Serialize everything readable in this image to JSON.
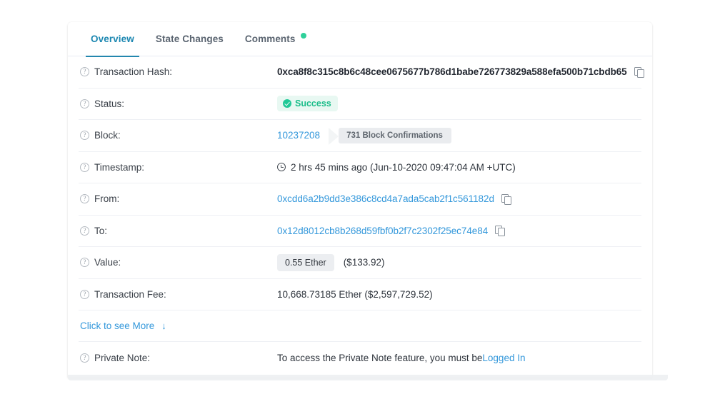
{
  "tabs": [
    {
      "label": "Overview",
      "active": true,
      "dot": false
    },
    {
      "label": "State Changes",
      "active": false,
      "dot": false
    },
    {
      "label": "Comments",
      "active": false,
      "dot": true
    }
  ],
  "rows": {
    "transaction_hash": {
      "label": "Transaction Hash:",
      "value": "0xca8f8c315c8b6c48cee0675677b786d1babe726773829a588efa500b71cbdb65"
    },
    "status": {
      "label": "Status:",
      "value": "Success"
    },
    "block": {
      "label": "Block:",
      "number": "10237208",
      "confirmations": "731 Block Confirmations"
    },
    "timestamp": {
      "label": "Timestamp:",
      "value": "2 hrs 45 mins ago (Jun-10-2020 09:47:04 AM +UTC)"
    },
    "from": {
      "label": "From:",
      "value": "0xcdd6a2b9dd3e386c8cd4a7ada5cab2f1c561182d"
    },
    "to": {
      "label": "To:",
      "value": "0x12d8012cb8b268d59fbf0b2f7c2302f25ec74e84"
    },
    "value": {
      "label": "Value:",
      "ether": "0.55 Ether",
      "usd": "($133.92)"
    },
    "transaction_fee": {
      "label": "Transaction Fee:",
      "value": "10,668.73185 Ether ($2,597,729.52)"
    },
    "see_more": {
      "label": "Click to see More",
      "arrow": "↓"
    },
    "private_note": {
      "label": "Private Note:",
      "text": "To access the Private Note feature, you must be ",
      "link": "Logged In"
    }
  },
  "icons": {
    "help": "?",
    "copy": "copy-icon",
    "clock": "clock-icon",
    "check": "check-icon"
  },
  "colors": {
    "accent": "#2387ae",
    "link": "#3498db",
    "success": "#20c997",
    "dot": "#2fd09a",
    "badge_gray": "#eaecef"
  }
}
